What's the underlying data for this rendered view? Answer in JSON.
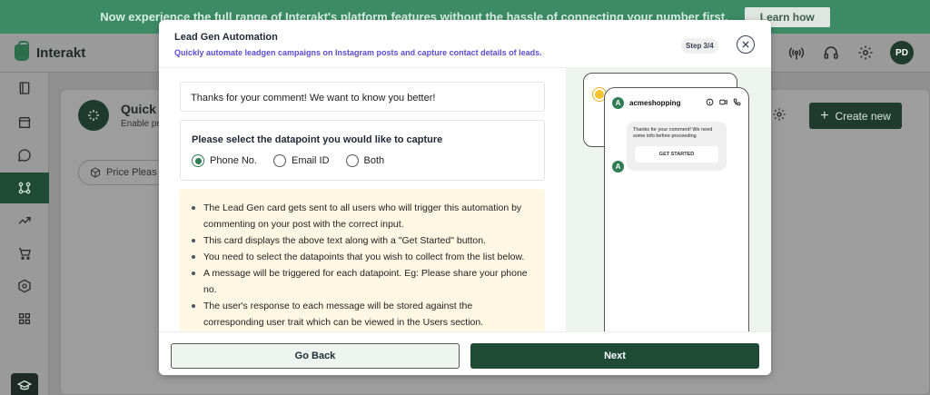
{
  "banner": {
    "text": "Now experience the full range of Interakt's platform features without the hassle of connecting your number first.",
    "button_label": "Learn how"
  },
  "header": {
    "brand_name": "Interakt",
    "avatar_initials": "PD",
    "icons": [
      "broadcast-icon",
      "headset-icon",
      "gear-icon"
    ]
  },
  "sidebar": {
    "icons": [
      "book-icon",
      "store-icon",
      "chat-icon",
      "workflow-icon",
      "trend-icon",
      "cart-icon",
      "hexagon-settings-icon",
      "grid-icon",
      "learn-icon"
    ],
    "active_index": 3
  },
  "background": {
    "quick_title": "Quick F",
    "quick_subtitle": "Enable pr",
    "price_chip": "Price Pleas",
    "create_button": "Create new"
  },
  "modal": {
    "title": "Lead Gen Automation",
    "subtitle": "Quickly automate leadgen campaigns on Instagram posts and capture contact details of leads.",
    "step": "Step 3/4",
    "thanks_text": "Thanks for your comment! We want to know you better!",
    "datapoint": {
      "title": "Please select the datapoint you would like to capture",
      "options": [
        {
          "label": "Phone No.",
          "checked": true
        },
        {
          "label": "Email ID",
          "checked": false
        },
        {
          "label": "Both",
          "checked": false
        }
      ]
    },
    "info_points": [
      "The Lead Gen card gets sent to all users who will trigger this automation by commenting  on your post with the correct input.",
      "This card displays the above text along with a \"Get Started\" button.",
      "You need to select the datapoints that you wish to collect from the list below.",
      "A message will be triggered for each datapoint. Eg: Please share your phone no.",
      "The user's response to each message will be stored against the corresponding user trait which can be viewed in the Users section."
    ],
    "preview": {
      "account_name": "acmeshopping",
      "avatar_letter": "A",
      "bubble_text": "Thanks for your comment! We need some info before proceeding",
      "bubble_button": "GET STARTED"
    },
    "footer": {
      "back_label": "Go Back",
      "next_label": "Next"
    }
  },
  "colors": {
    "banner": "#3d8a66",
    "primary": "#1f4a36",
    "accent_purple": "#5b4ccf",
    "info_bg": "#fdf7e3"
  }
}
